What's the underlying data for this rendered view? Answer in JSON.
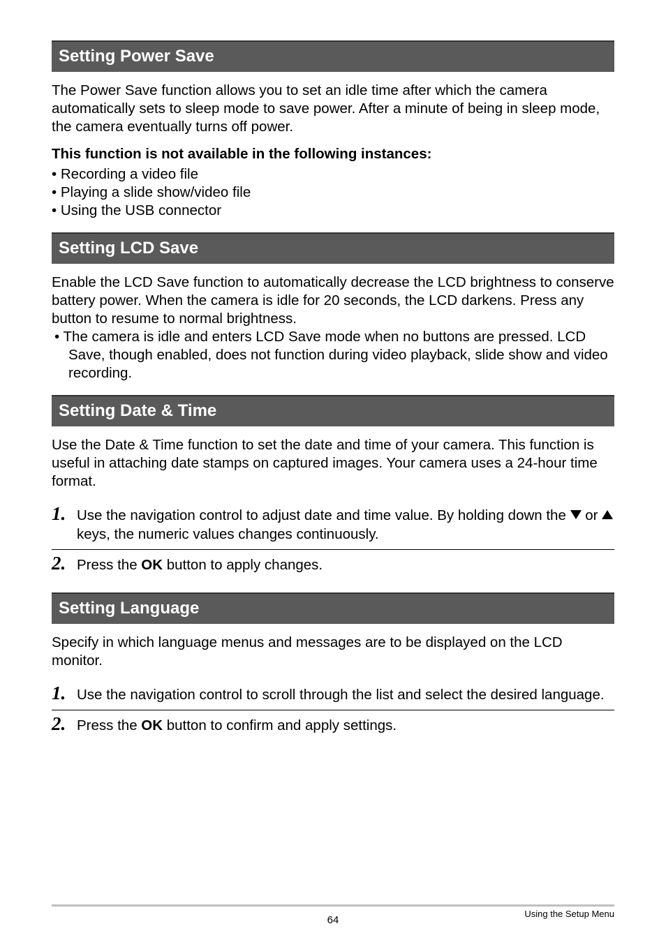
{
  "sections": {
    "powerSave": {
      "heading": "Setting Power Save",
      "body": "The Power Save function allows you to set an idle time after which the camera automatically sets to sleep mode to save power. After a minute of being in sleep mode, the camera eventually turns off power.",
      "unavailableHeading": "This function is not available in the following instances:",
      "bullets": [
        "Recording a video file",
        "Playing a slide show/video file",
        "Using the USB connector"
      ]
    },
    "lcdSave": {
      "heading": "Setting LCD Save",
      "body": "Enable the LCD Save function to automatically decrease the LCD brightness to conserve battery power. When the camera is idle for 20 seconds, the LCD darkens. Press any button to resume to normal brightness.",
      "bullets": [
        "The camera is idle and enters LCD Save mode when no buttons are pressed. LCD Save, though enabled, does not function during video playback, slide show and video recording."
      ]
    },
    "dateTime": {
      "heading": "Setting Date & Time",
      "body": "Use the Date & Time function to set the date and time of your camera. This function is useful in attaching date stamps on captured images. Your camera uses a 24-hour time format.",
      "steps": {
        "s1_pre": "Use the navigation control to adjust date and time value. By holding down the ",
        "s1_mid": " or ",
        "s1_post": " keys, the numeric values changes continuously.",
        "s2_pre": "Press the ",
        "s2_ok": "OK",
        "s2_post": " button to apply changes."
      }
    },
    "language": {
      "heading": "Setting Language",
      "body": "Specify in which language menus and messages are to be displayed on the LCD monitor.",
      "steps": {
        "s1": "Use the navigation control to scroll through the list and select the desired language.",
        "s2_pre": "Press the ",
        "s2_ok": "OK",
        "s2_post": " button to confirm and apply settings."
      }
    }
  },
  "numbers": {
    "one": "1",
    "two": "2"
  },
  "footer": {
    "label": "Using the Setup Menu",
    "page": "64"
  }
}
